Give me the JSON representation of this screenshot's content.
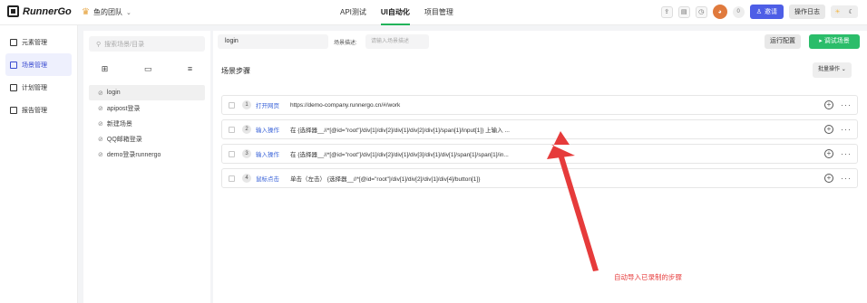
{
  "app": {
    "logo_text": "RunnerGo",
    "team": "鱼的团队"
  },
  "nav": [
    {
      "label": "API测试"
    },
    {
      "label": "UI自动化"
    },
    {
      "label": "项目管理"
    }
  ],
  "header": {
    "count_badge": "0",
    "invite_label": "邀请",
    "oplog_label": "操作日志"
  },
  "sidebar": {
    "items": [
      {
        "label": "元素管理"
      },
      {
        "label": "场景管理"
      },
      {
        "label": "计划管理"
      },
      {
        "label": "报告管理"
      }
    ]
  },
  "panel": {
    "search_placeholder": "搜索场景/目录",
    "tree": [
      {
        "label": "login"
      },
      {
        "label": "apipost登录"
      },
      {
        "label": "新建场景"
      },
      {
        "label": "QQ邮箱登录"
      },
      {
        "label": "demo登录runnergo"
      }
    ]
  },
  "main": {
    "scene_name": "login",
    "desc_label": "场景描述:",
    "desc_placeholder": "请输入场景描述",
    "run_config": "运行配置",
    "debug": "调试场景",
    "section_title": "场景步骤",
    "batch": "批量操作",
    "steps": [
      {
        "num": "1",
        "type": "打开网页",
        "detail": "https://demo-company.runnergo.cn/#/work"
      },
      {
        "num": "2",
        "type": "输入操作",
        "detail": "在 {选择器__//*[@id=\"root\"]/div[1]/div[2]/div[1]/div[2]/div[1]/span[1]/input[1]} 上输入 ..."
      },
      {
        "num": "3",
        "type": "输入操作",
        "detail": "在 {选择器__//*[@id=\"root\"]/div[1]/div[2]/div[1]/div[3]/div[1]/div[1]/span[1]/span[1]/in..."
      },
      {
        "num": "4",
        "type": "鼠标点击",
        "detail": "单击（左击） {选择器__//*[@id=\"root\"]/div[1]/div[2]/div[1]/div[4]/button[1]}"
      }
    ]
  },
  "annotation": {
    "text": "自动导入已录制的步骤",
    "color": "#e63b3b"
  },
  "colors": {
    "accent_green": "#2bbd6a",
    "accent_blue": "#4d5ee6",
    "link_blue": "#3a63d8"
  }
}
